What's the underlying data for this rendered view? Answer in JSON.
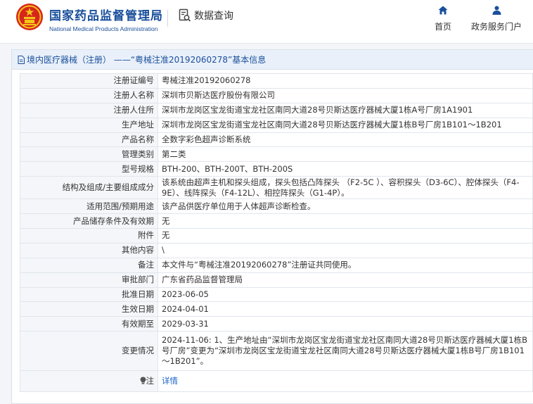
{
  "header": {
    "brand_cn": "国家药品监督管理局",
    "brand_en": "National Medical Products Administration",
    "query_label": "数据查询",
    "nav_home": "首页",
    "nav_gov": "政务服务门户"
  },
  "panel": {
    "title": "境内医疗器械（注册） ——“粤械注准20192060278”基本信息"
  },
  "rows": [
    {
      "k": "注册证编号",
      "v": "粤械注准20192060278"
    },
    {
      "k": "注册人名称",
      "v": "深圳市贝斯达医疗股份有限公司"
    },
    {
      "k": "注册人住所",
      "v": "深圳市龙岗区宝龙街道宝龙社区南同大道28号贝斯达医疗器械大厦1栋A号厂房1A1901"
    },
    {
      "k": "生产地址",
      "v": "深圳市龙岗区宝龙街道宝龙社区南同大道28号贝斯达医疗器械大厦1栋B号厂房1B101～1B201"
    },
    {
      "k": "产品名称",
      "v": "全数字彩色超声诊断系统"
    },
    {
      "k": "管理类别",
      "v": "第二类"
    },
    {
      "k": "型号规格",
      "v": "BTH-200、BTH-200T、BTH-200S"
    },
    {
      "k": "结构及组成/主要组成成分",
      "v": "该系统由超声主机和探头组成，探头包括凸阵探头 （F2-5C ）、容积探头（D3-6C）、腔体探头（F4-9E）、线阵探头（F4-12L）、相控阵探头（G1-4P）。"
    },
    {
      "k": "适用范围/预期用途",
      "v": "该产品供医疗单位用于人体超声诊断检查。"
    },
    {
      "k": "产品储存条件及有效期",
      "v": "无"
    },
    {
      "k": "附件",
      "v": "无"
    },
    {
      "k": "其他内容",
      "v": "\\"
    },
    {
      "k": "备注",
      "v": "本文件与“粤械注准20192060278”注册证共同使用。"
    },
    {
      "k": "审批部门",
      "v": "广东省药品监督管理局"
    },
    {
      "k": "批准日期",
      "v": "2023-06-05"
    },
    {
      "k": "生效日期",
      "v": "2024-04-01"
    },
    {
      "k": "有效期至",
      "v": "2029-03-31"
    },
    {
      "k": "变更情况",
      "v": "2024-11-06: 1、生产地址由“深圳市龙岗区宝龙街道宝龙社区南同大道28号贝斯达医疗器械大厦1栋B号厂房”变更为“深圳市龙岗区宝龙街道宝龙社区南同大道28号贝斯达医疗器械大厦1栋B号厂房1B101～1B201”。"
    }
  ],
  "note": {
    "label": "注",
    "link": "详情"
  }
}
